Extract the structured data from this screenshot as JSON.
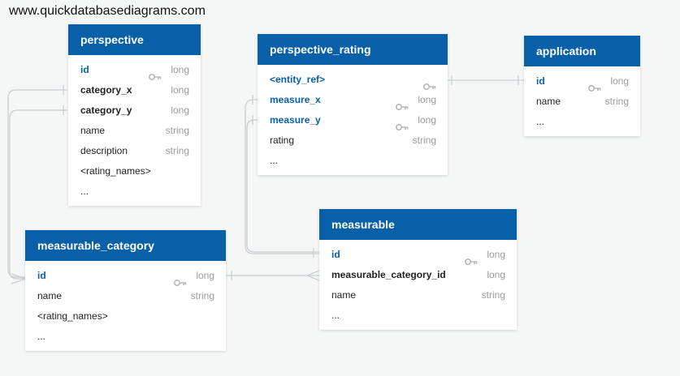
{
  "watermark": "www.quickdatabasediagrams.com",
  "tables": {
    "perspective": {
      "title": "perspective",
      "rows": [
        {
          "name": "id",
          "type": "long",
          "key": true,
          "style": "blue"
        },
        {
          "name": "category_x",
          "type": "long",
          "key": false,
          "style": "bold"
        },
        {
          "name": "category_y",
          "type": "long",
          "key": false,
          "style": "bold"
        },
        {
          "name": "name",
          "type": "string",
          "key": false,
          "style": "normal"
        },
        {
          "name": "description",
          "type": "string",
          "key": false,
          "style": "normal"
        },
        {
          "name": "<rating_names>",
          "type": "",
          "key": false,
          "style": "normal"
        },
        {
          "name": "...",
          "type": "",
          "key": false,
          "style": "normal"
        }
      ]
    },
    "perspective_rating": {
      "title": "perspective_rating",
      "rows": [
        {
          "name": "<entity_ref>",
          "type": "",
          "key": true,
          "style": "blue"
        },
        {
          "name": "measure_x",
          "type": "long",
          "key": true,
          "style": "blue"
        },
        {
          "name": "measure_y",
          "type": "long",
          "key": true,
          "style": "blue"
        },
        {
          "name": "rating",
          "type": "string",
          "key": false,
          "style": "normal"
        },
        {
          "name": "...",
          "type": "",
          "key": false,
          "style": "normal"
        }
      ]
    },
    "application": {
      "title": "application",
      "rows": [
        {
          "name": "id",
          "type": "long",
          "key": true,
          "style": "blue"
        },
        {
          "name": "name",
          "type": "string",
          "key": false,
          "style": "normal"
        },
        {
          "name": "...",
          "type": "",
          "key": false,
          "style": "normal"
        }
      ]
    },
    "measurable_category": {
      "title": "measurable_category",
      "rows": [
        {
          "name": "id",
          "type": "long",
          "key": true,
          "style": "blue"
        },
        {
          "name": "name",
          "type": "string",
          "key": false,
          "style": "normal"
        },
        {
          "name": "<rating_names>",
          "type": "",
          "key": false,
          "style": "normal"
        },
        {
          "name": "...",
          "type": "",
          "key": false,
          "style": "normal"
        }
      ]
    },
    "measurable": {
      "title": "measurable",
      "rows": [
        {
          "name": "id",
          "type": "long",
          "key": true,
          "style": "blue"
        },
        {
          "name": "measurable_category_id",
          "type": "long",
          "key": false,
          "style": "bold"
        },
        {
          "name": "name",
          "type": "string",
          "key": false,
          "style": "normal"
        },
        {
          "name": "...",
          "type": "",
          "key": false,
          "style": "normal"
        }
      ]
    }
  },
  "icons": {
    "key": "key-icon"
  },
  "colors": {
    "header": "#0860a8",
    "connector": "#c9ced3",
    "key": "#b8b8b8"
  }
}
